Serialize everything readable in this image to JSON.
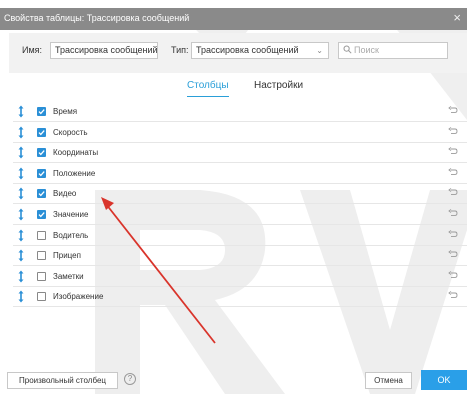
{
  "dialog": {
    "title": "Свойства таблицы: Трассировка сообщений",
    "close_glyph": "×"
  },
  "form": {
    "name_label": "Имя:",
    "name_value": "Трассировка сообщений",
    "type_label": "Тип:",
    "type_value": "Трассировка сообщений",
    "type_chevron": "⌄",
    "search_placeholder": "Поиск"
  },
  "tabs": [
    {
      "label": "Столбцы",
      "active": true
    },
    {
      "label": "Настройки",
      "active": false
    }
  ],
  "columns": [
    {
      "label": "Время",
      "checked": true
    },
    {
      "label": "Скорость",
      "checked": true
    },
    {
      "label": "Координаты",
      "checked": true
    },
    {
      "label": "Положение",
      "checked": true
    },
    {
      "label": "Видео",
      "checked": true
    },
    {
      "label": "Значение",
      "checked": true
    },
    {
      "label": "Водитель",
      "checked": false
    },
    {
      "label": "Прицеп",
      "checked": false
    },
    {
      "label": "Заметки",
      "checked": false
    },
    {
      "label": "Изображение",
      "checked": false
    }
  ],
  "footer": {
    "custom_column_label": "Произвольный столбец",
    "help_glyph": "?",
    "cancel_label": "Отмена",
    "ok_label": "OK"
  },
  "colors": {
    "accent": "#2a9fd8",
    "titlebar": "#8a8a8a",
    "checkbox": "#2a8fd6",
    "annotation_arrow": "#d9342b"
  },
  "icons": {
    "drag": "drag-handle-icon",
    "checkbox": "checkbox-icon",
    "reset": "undo-icon",
    "search": "search-icon",
    "close": "close-icon",
    "help": "help-icon"
  }
}
